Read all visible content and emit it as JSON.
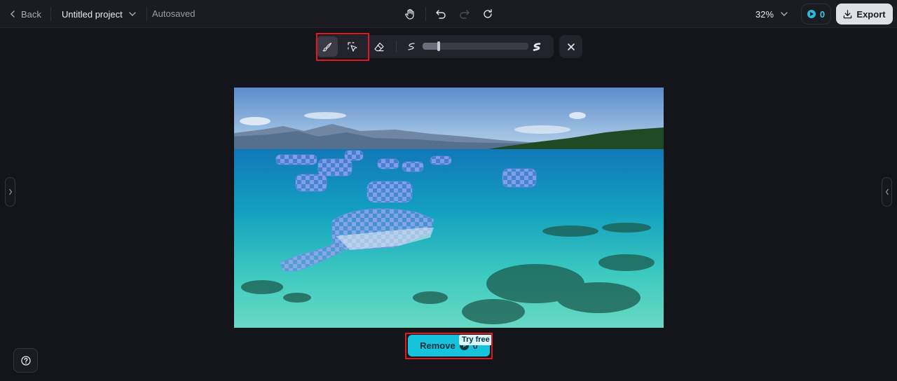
{
  "header": {
    "back_label": "Back",
    "project_title": "Untitled project",
    "save_status": "Autosaved",
    "zoom": "32%",
    "credits": "0",
    "export_label": "Export"
  },
  "toolbar": {
    "tools": [
      "brush",
      "smart-select",
      "eraser"
    ],
    "active_tool": "brush",
    "brush_size_fraction": 0.15
  },
  "actions": {
    "remove_label": "Remove",
    "remove_cost": "0",
    "try_free_badge": "Try free"
  },
  "colors": {
    "accent": "#16c3dd",
    "highlight": "#e3171d",
    "background": "#14151a"
  }
}
